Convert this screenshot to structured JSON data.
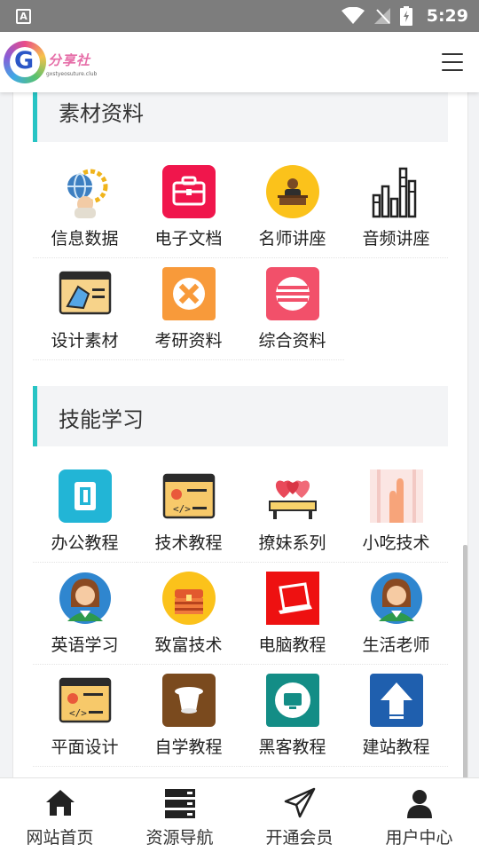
{
  "status_bar": {
    "app_badge": "A",
    "time": "5:29"
  },
  "header": {
    "logo_letter": "G",
    "logo_text": "分享社",
    "logo_subtext": "gxstyeosuture.club"
  },
  "sections": [
    {
      "title": "素材资料",
      "items": [
        {
          "label": "信息数据",
          "icon": "data-globe-icon"
        },
        {
          "label": "电子文档",
          "icon": "toolbox-icon"
        },
        {
          "label": "名师讲座",
          "icon": "lecturer-icon"
        },
        {
          "label": "音频讲座",
          "icon": "audio-bars-icon"
        },
        {
          "label": "设计素材",
          "icon": "design-window-icon"
        },
        {
          "label": "考研资料",
          "icon": "pencil-ruler-icon"
        },
        {
          "label": "综合资料",
          "icon": "stack-icon"
        }
      ]
    },
    {
      "title": "技能学习",
      "items": [
        {
          "label": "办公教程",
          "icon": "office-icon"
        },
        {
          "label": "技术教程",
          "icon": "code-window-icon"
        },
        {
          "label": "撩妹系列",
          "icon": "hearts-bench-icon"
        },
        {
          "label": "小吃技术",
          "icon": "hand-icon"
        },
        {
          "label": "英语学习",
          "icon": "woman-avatar-icon"
        },
        {
          "label": "致富技术",
          "icon": "treasure-chest-icon"
        },
        {
          "label": "电脑教程",
          "icon": "laptop-icon"
        },
        {
          "label": "生活老师",
          "icon": "woman-avatar-icon"
        },
        {
          "label": "平面设计",
          "icon": "code-window-icon"
        },
        {
          "label": "自学教程",
          "icon": "hat-icon"
        },
        {
          "label": "黑客教程",
          "icon": "monitor-icon"
        },
        {
          "label": "建站教程",
          "icon": "upload-arrow-icon"
        }
      ]
    }
  ],
  "tab_bar": [
    {
      "label": "网站首页",
      "icon": "home-icon"
    },
    {
      "label": "资源导航",
      "icon": "server-icon"
    },
    {
      "label": "开通会员",
      "icon": "paper-plane-icon"
    },
    {
      "label": "用户中心",
      "icon": "user-icon"
    }
  ],
  "colors": {
    "accent": "#27c4c4",
    "status_bar": "#7d7d7d"
  }
}
